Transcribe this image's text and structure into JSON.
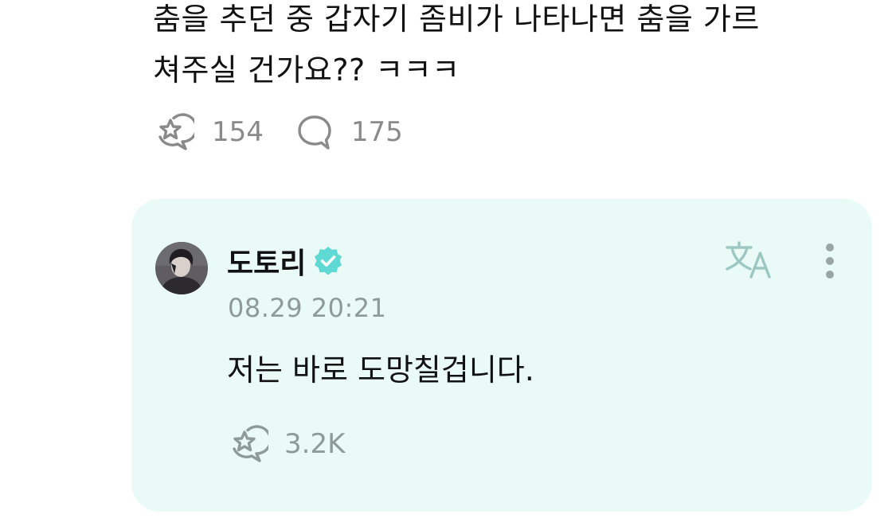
{
  "post": {
    "text": "춤을 추던 중 갑자기 좀비가 나타나면 춤을 가르\n쳐주실 건가요?? ㅋㅋㅋ",
    "like_count": "154",
    "comment_count": "175",
    "like_icon": "like-icon",
    "comment_icon": "comment-icon"
  },
  "reply": {
    "username": "도토리",
    "verified_icon": "verified-badge-icon",
    "timestamp": "08.29 20:21",
    "text": "저는 바로 도망칠겁니다.",
    "like_count": "3.2K",
    "translate_icon": "translate-icon",
    "more_icon": "more-vertical-icon"
  },
  "colors": {
    "card_background": "#eafaf6",
    "verified": "#5fd9d3",
    "muted_icon": "#8a8a8a",
    "muted_text_card": "#8e9a97",
    "translate_icon": "#9cc7c2"
  }
}
